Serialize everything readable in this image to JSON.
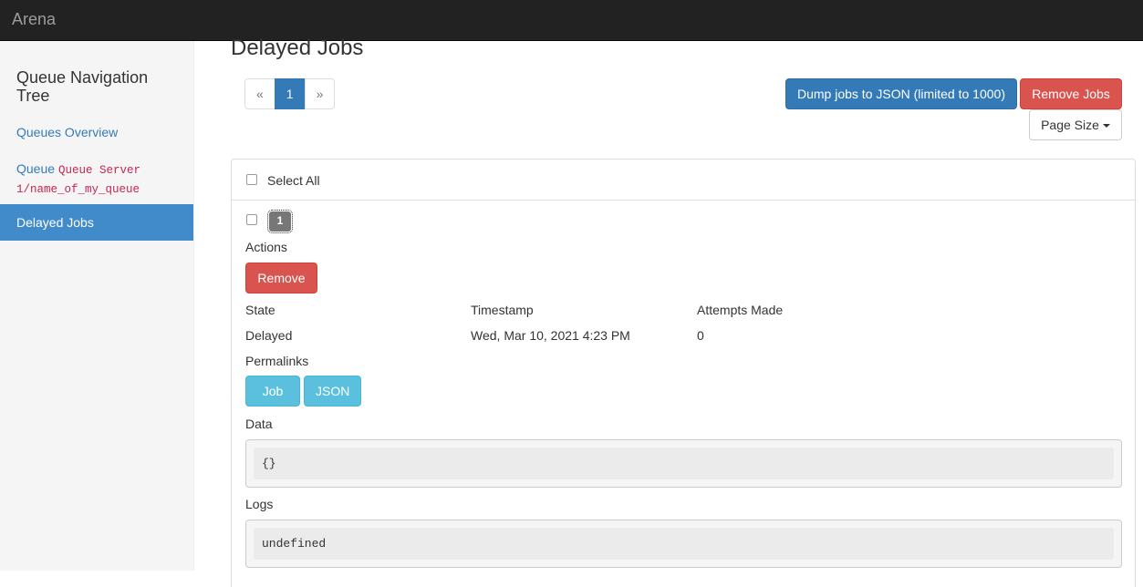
{
  "app": {
    "brand": "Arena"
  },
  "sidebar": {
    "title": "Queue Navigation Tree",
    "overview_label": "Queues Overview",
    "queue_prefix": "Queue",
    "queue_name": "Queue Server 1/name_of_my_queue",
    "active_label": "Delayed Jobs"
  },
  "main": {
    "title": "Delayed Jobs",
    "pagination": {
      "prev": "«",
      "current": "1",
      "next": "»"
    },
    "dump_label": "Dump jobs to JSON (limited to 1000)",
    "remove_jobs_label": "Remove Jobs",
    "page_size_label": "Page Size",
    "select_all_label": "Select All"
  },
  "job": {
    "id": "1",
    "actions_label": "Actions",
    "remove_label": "Remove",
    "headers": {
      "state": "State",
      "timestamp": "Timestamp",
      "attempts": "Attempts Made"
    },
    "values": {
      "state": "Delayed",
      "timestamp": "Wed, Mar 10, 2021 4:23 PM",
      "attempts": "0"
    },
    "permalinks_label": "Permalinks",
    "permalink_job": "Job 1",
    "permalink_json": "JSON",
    "data_label": "Data",
    "data_value": "{}",
    "logs_label": "Logs",
    "logs_value": "undefined"
  },
  "colors": {
    "primary": "#337ab7",
    "danger": "#d9534f",
    "info": "#5bc0de",
    "active_nav": "#428bca",
    "navbar": "#222222"
  }
}
